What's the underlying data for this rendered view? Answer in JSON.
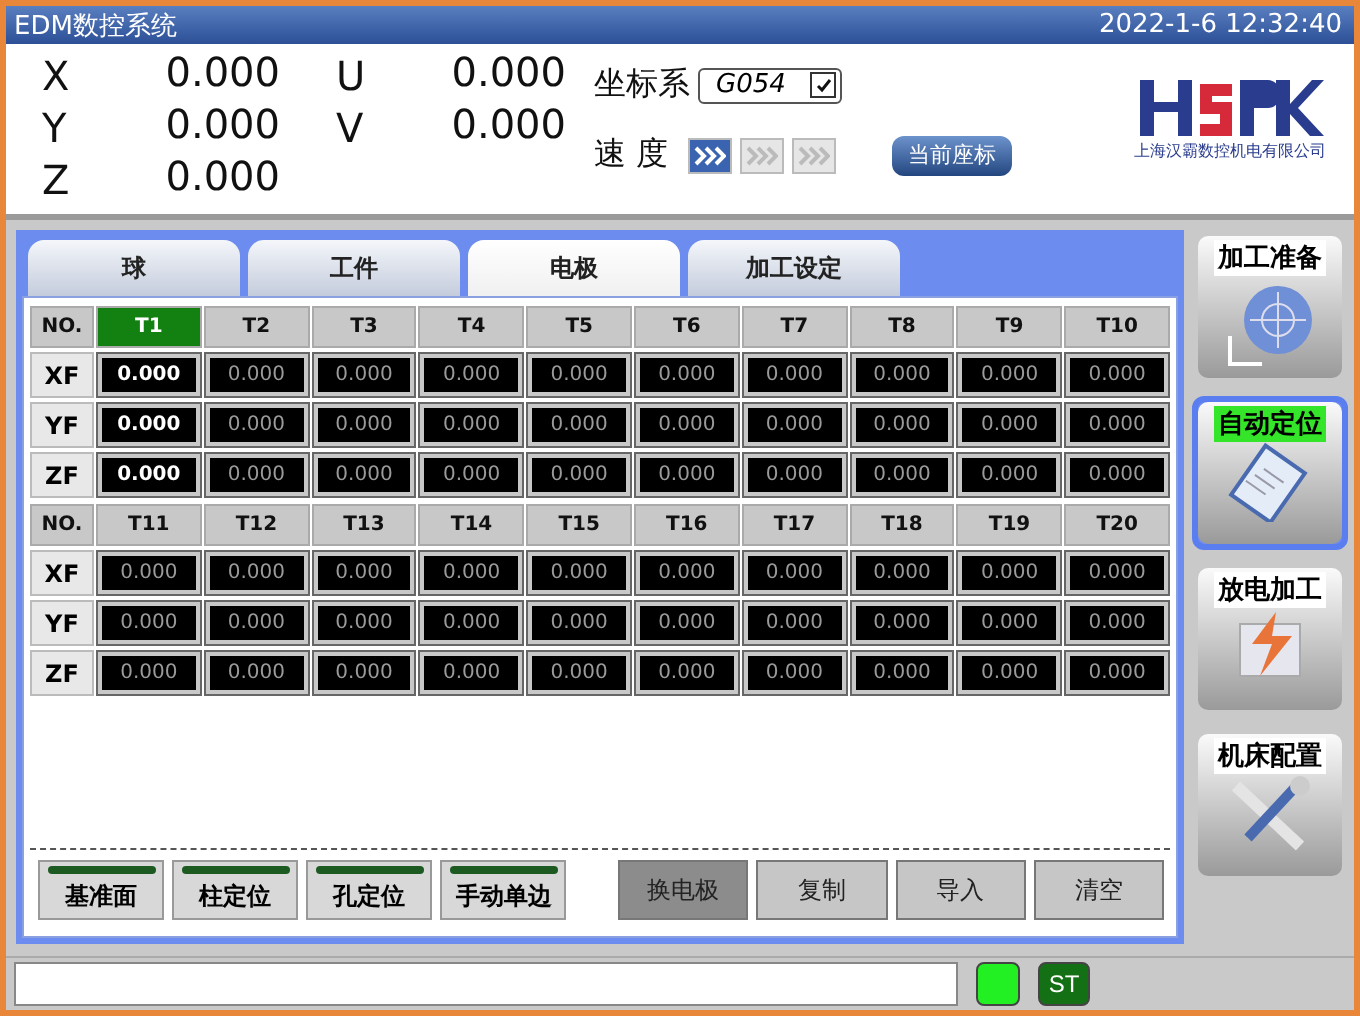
{
  "window": {
    "title": "EDM数控系统",
    "datetime": "2022-1-6 12:32:40"
  },
  "axes": [
    {
      "label": "X",
      "value": "0.000"
    },
    {
      "label": "Y",
      "value": "0.000"
    },
    {
      "label": "Z",
      "value": "0.000"
    },
    {
      "label": "U",
      "value": "0.000"
    },
    {
      "label": "V",
      "value": "0.000"
    }
  ],
  "coordinate_system": {
    "label": "坐标系",
    "value": "G054",
    "checked": true
  },
  "speed": {
    "label": "速 度",
    "steps": [
      {
        "selected": true
      },
      {
        "selected": false
      },
      {
        "selected": false
      }
    ]
  },
  "current_coords_button": "当前座标",
  "logo": {
    "company": "上海汉霸数控机电有限公司"
  },
  "tabs": [
    {
      "label": "球",
      "selected": false
    },
    {
      "label": "工件",
      "selected": false
    },
    {
      "label": "电极",
      "selected": true
    },
    {
      "label": "加工设定",
      "selected": false
    }
  ],
  "grid_blocks": [
    {
      "header": "NO.",
      "columns": [
        {
          "label": "T1",
          "selected": true
        },
        {
          "label": "T2",
          "selected": false
        },
        {
          "label": "T3",
          "selected": false
        },
        {
          "label": "T4",
          "selected": false
        },
        {
          "label": "T5",
          "selected": false
        },
        {
          "label": "T6",
          "selected": false
        },
        {
          "label": "T7",
          "selected": false
        },
        {
          "label": "T8",
          "selected": false
        },
        {
          "label": "T9",
          "selected": false
        },
        {
          "label": "T10",
          "selected": false
        }
      ],
      "rows": [
        {
          "label": "XF",
          "values": [
            "0.000",
            "0.000",
            "0.000",
            "0.000",
            "0.000",
            "0.000",
            "0.000",
            "0.000",
            "0.000",
            "0.000"
          ]
        },
        {
          "label": "YF",
          "values": [
            "0.000",
            "0.000",
            "0.000",
            "0.000",
            "0.000",
            "0.000",
            "0.000",
            "0.000",
            "0.000",
            "0.000"
          ]
        },
        {
          "label": "ZF",
          "values": [
            "0.000",
            "0.000",
            "0.000",
            "0.000",
            "0.000",
            "0.000",
            "0.000",
            "0.000",
            "0.000",
            "0.000"
          ]
        }
      ]
    },
    {
      "header": "NO.",
      "columns": [
        {
          "label": "T11",
          "selected": false
        },
        {
          "label": "T12",
          "selected": false
        },
        {
          "label": "T13",
          "selected": false
        },
        {
          "label": "T14",
          "selected": false
        },
        {
          "label": "T15",
          "selected": false
        },
        {
          "label": "T16",
          "selected": false
        },
        {
          "label": "T17",
          "selected": false
        },
        {
          "label": "T18",
          "selected": false
        },
        {
          "label": "T19",
          "selected": false
        },
        {
          "label": "T20",
          "selected": false
        }
      ],
      "rows": [
        {
          "label": "XF",
          "values": [
            "0.000",
            "0.000",
            "0.000",
            "0.000",
            "0.000",
            "0.000",
            "0.000",
            "0.000",
            "0.000",
            "0.000"
          ]
        },
        {
          "label": "YF",
          "values": [
            "0.000",
            "0.000",
            "0.000",
            "0.000",
            "0.000",
            "0.000",
            "0.000",
            "0.000",
            "0.000",
            "0.000"
          ]
        },
        {
          "label": "ZF",
          "values": [
            "0.000",
            "0.000",
            "0.000",
            "0.000",
            "0.000",
            "0.000",
            "0.000",
            "0.000",
            "0.000",
            "0.000"
          ]
        }
      ]
    }
  ],
  "mode_buttons": [
    {
      "label": "基准面",
      "on": false
    },
    {
      "label": "柱定位",
      "on": false
    },
    {
      "label": "孔定位",
      "on": false
    },
    {
      "label": "手动单边",
      "on": false
    }
  ],
  "action_buttons": [
    {
      "label": "换电极",
      "selected": true
    },
    {
      "label": "复制",
      "selected": false
    },
    {
      "label": "导入",
      "selected": false
    },
    {
      "label": "清空",
      "selected": false
    }
  ],
  "side_buttons": [
    {
      "label": "加工准备",
      "kind": "target",
      "selected": false
    },
    {
      "label": "自动定位",
      "kind": "clipboard",
      "selected": true
    },
    {
      "label": "放电加工",
      "kind": "spark",
      "selected": false
    },
    {
      "label": "机床配置",
      "kind": "tools",
      "selected": false
    }
  ],
  "status_bar": {
    "indicator_on": true,
    "st_button": "ST"
  }
}
